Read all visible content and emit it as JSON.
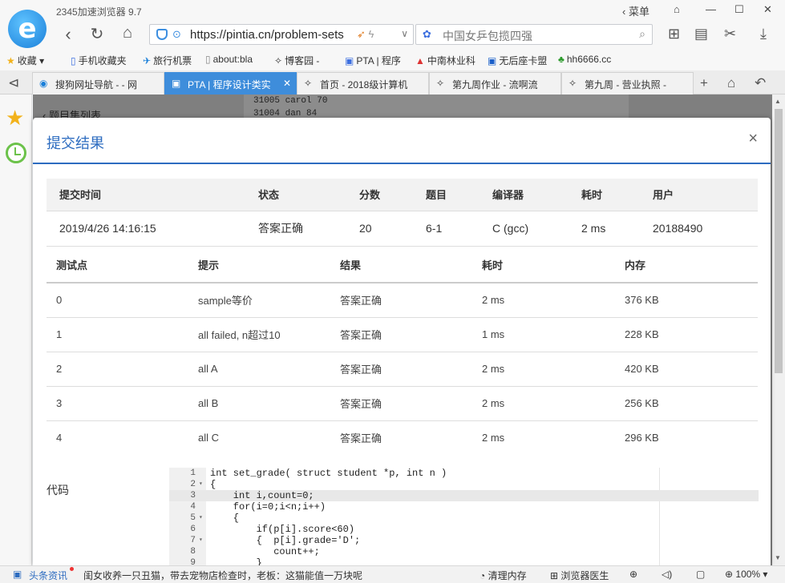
{
  "browser": {
    "app_title": "2345加速浏览器 9.7",
    "menu_label": "菜单",
    "address": "https://pintia.cn/problem-sets",
    "search_placeholder": "中国女乒包揽四强"
  },
  "bookmarks": [
    {
      "label": "收藏"
    },
    {
      "label": "手机收藏夹"
    },
    {
      "label": "旅行机票"
    },
    {
      "label": "about:bla"
    },
    {
      "label": "博客园 -"
    },
    {
      "label": "PTA | 程序"
    },
    {
      "label": "中南林业科"
    },
    {
      "label": "无后座卡盟"
    },
    {
      "label": "hh6666.cc"
    }
  ],
  "tabs": [
    {
      "label": "搜狗网址导航 - - 网"
    },
    {
      "label": "PTA | 程序设计类实"
    },
    {
      "label": "首页 - 2018级计算机"
    },
    {
      "label": "第九周作业 - 流啊流"
    },
    {
      "label": "第九周 - 营业执照 -"
    }
  ],
  "background_page": {
    "back_link": "题目集列表",
    "lines": [
      "31005 carol 70",
      "31004 dan 84"
    ]
  },
  "modal": {
    "title": "提交结果",
    "close": "×",
    "summary_headers": [
      "提交时间",
      "状态",
      "分数",
      "题目",
      "编译器",
      "耗时",
      "用户"
    ],
    "summary_row": [
      "2019/4/26 14:16:15",
      "答案正确",
      "20",
      "6-1",
      "C (gcc)",
      "2 ms",
      "20188490"
    ],
    "test_headers": [
      "测试点",
      "提示",
      "结果",
      "耗时",
      "内存"
    ],
    "test_rows": [
      [
        "0",
        "sample等价",
        "答案正确",
        "2 ms",
        "376 KB"
      ],
      [
        "1",
        "all failed, n超过10",
        "答案正确",
        "1 ms",
        "228 KB"
      ],
      [
        "2",
        "all A",
        "答案正确",
        "2 ms",
        "420 KB"
      ],
      [
        "3",
        "all B",
        "答案正确",
        "2 ms",
        "256 KB"
      ],
      [
        "4",
        "all C",
        "答案正确",
        "2 ms",
        "296 KB"
      ]
    ],
    "code_label": "代码",
    "code_lines": [
      {
        "n": "1",
        "fold": "",
        "text": "int set_grade( struct student *p, int n )"
      },
      {
        "n": "2",
        "fold": "▾",
        "text": "{"
      },
      {
        "n": "3",
        "fold": "",
        "text": "    int i,count=0;"
      },
      {
        "n": "4",
        "fold": "",
        "text": "    for(i=0;i<n;i++)"
      },
      {
        "n": "5",
        "fold": "▾",
        "text": "    {"
      },
      {
        "n": "6",
        "fold": "",
        "text": "        if(p[i].score<60)"
      },
      {
        "n": "7",
        "fold": "▾",
        "text": "        {  p[i].grade='D';"
      },
      {
        "n": "8",
        "fold": "",
        "text": "           count++;"
      },
      {
        "n": "9",
        "fold": "",
        "text": "        }"
      }
    ]
  },
  "statusbar": {
    "news_label": "头条资讯",
    "news_text": "闺女收养一只丑猫，带去宠物店检查时，老板：这猫能值一万块呢",
    "clean_memory": "清理内存",
    "doctor": "浏览器医生",
    "zoom": "100%"
  },
  "colors": {
    "accent": "#2d6cc0",
    "accepted": "#e04a3c",
    "active_tab": "#3e8ddb"
  }
}
